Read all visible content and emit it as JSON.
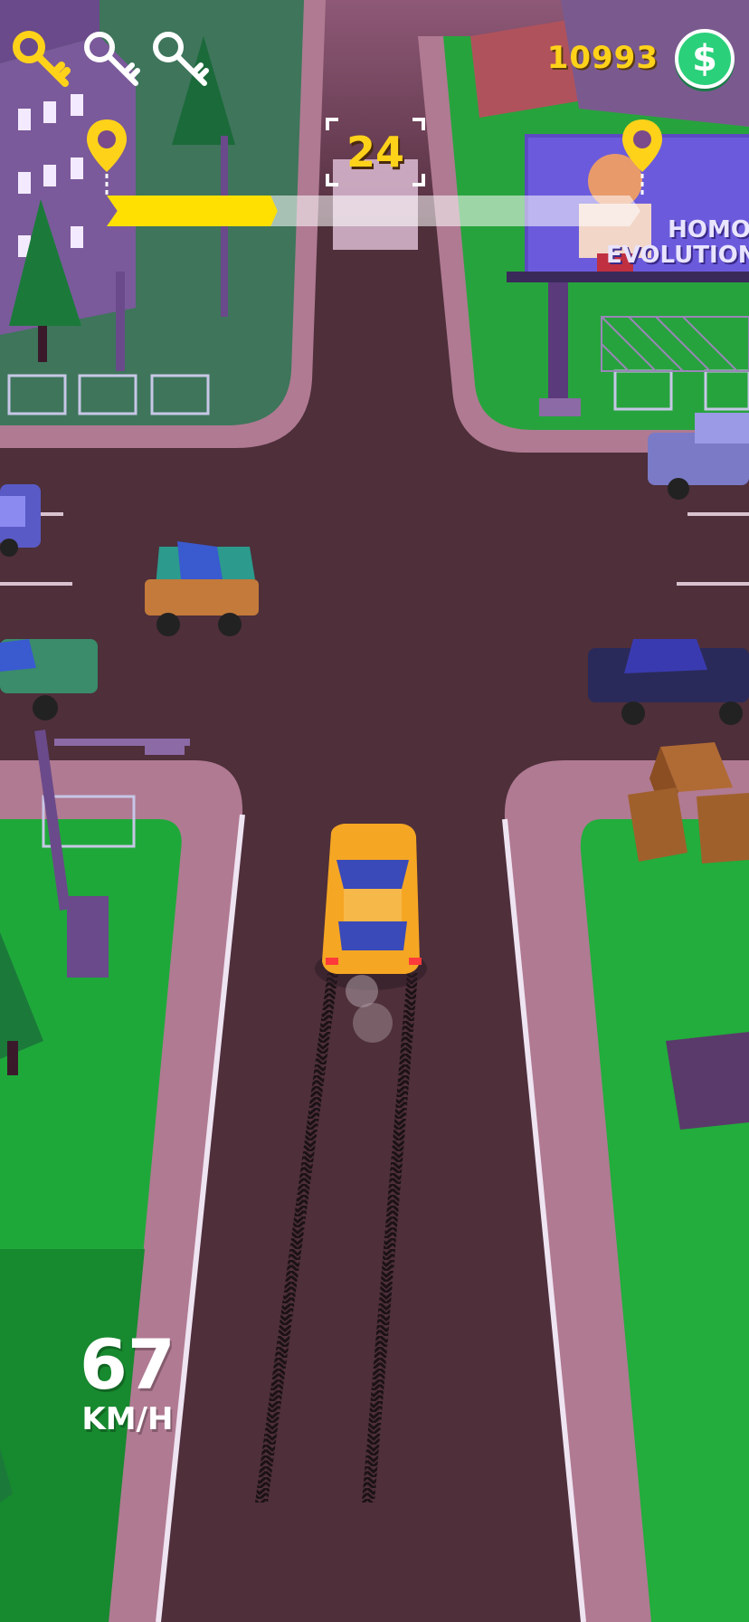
{
  "hud": {
    "keys": [
      {
        "icon": "key-icon",
        "state": "collected",
        "color": "#ffd21a"
      },
      {
        "icon": "key-icon",
        "state": "empty",
        "color": "#ffffff"
      },
      {
        "icon": "key-icon",
        "state": "empty",
        "color": "#ffffff"
      }
    ],
    "coins": "10993",
    "currency_symbol": "$",
    "level": "24",
    "progress": 0.32,
    "speed": {
      "value": "67",
      "unit": "KM/H"
    }
  },
  "billboard": {
    "line1": "HOMO",
    "line2": "EVOLUTION"
  },
  "colors": {
    "accent": "#ffd21a",
    "progress_fill": "#ffe000",
    "coin_badge": "#2bd07a",
    "road": "#4e2f3a",
    "sidewalk": "#b07a92",
    "grass": "#1fa83a",
    "player_car": "#f5a623"
  }
}
